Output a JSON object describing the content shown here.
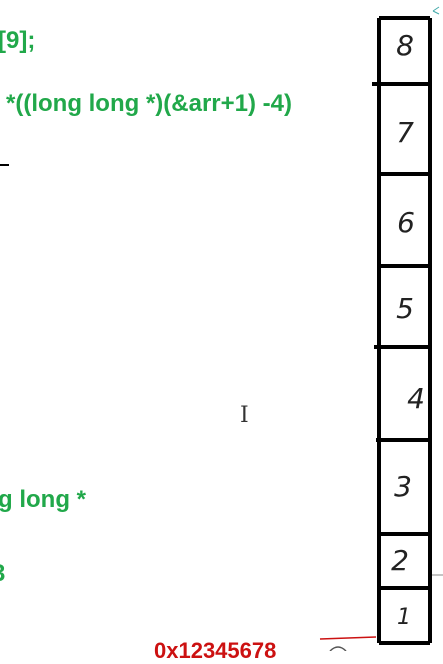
{
  "code_lines": [
    "[9];",
    "*((long long *)(&arr+1) -4)",
    "g long *",
    "3"
  ],
  "address_label": "0x12345678",
  "cell_digits": [
    "8",
    "7",
    "6",
    "5",
    "4",
    "3",
    "2",
    "1"
  ],
  "colors": {
    "code_text": "#21a84a",
    "address_text": "#cc1111",
    "ink": "#000000",
    "background": "#ffffff"
  }
}
